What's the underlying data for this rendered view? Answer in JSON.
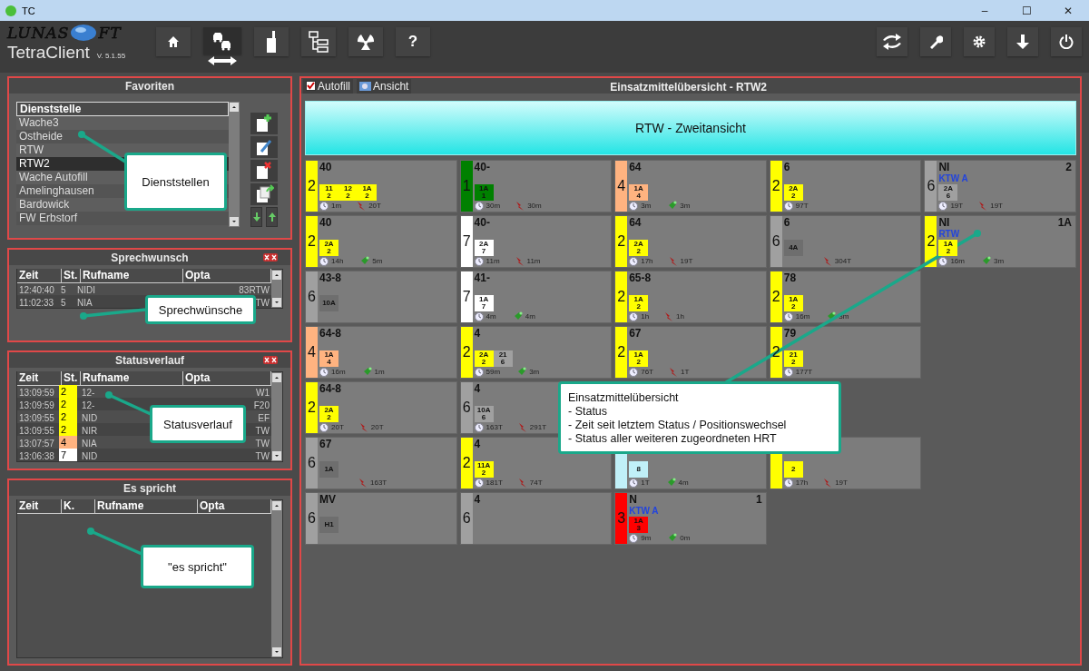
{
  "window": {
    "title": "TC",
    "controls": [
      "–",
      "☐",
      "✕"
    ]
  },
  "header": {
    "logo_left": "LUNAS",
    "logo_right": "FT",
    "app": "TetraClient",
    "version": "V. 5.1.55"
  },
  "tools": [
    {
      "kind": "home",
      "selected": false
    },
    {
      "kind": "vehicles",
      "selected": true
    },
    {
      "kind": "radio",
      "selected": false
    },
    {
      "kind": "tree",
      "selected": false
    },
    {
      "kind": "radiation",
      "selected": false
    },
    {
      "kind": "help",
      "selected": false,
      "label": "?"
    }
  ],
  "right_tools": [
    {
      "kind": "swap"
    },
    {
      "kind": "wrench"
    },
    {
      "kind": "gear"
    },
    {
      "kind": "download"
    },
    {
      "kind": "power"
    }
  ],
  "favorites": {
    "title": "Favoriten",
    "column": "Dienststelle",
    "items": [
      {
        "label": "Wache3",
        "selected": false
      },
      {
        "label": "Ostheide",
        "selected": false
      },
      {
        "label": "RTW",
        "selected": false
      },
      {
        "label": "RTW2",
        "selected": true
      },
      {
        "label": "Wache Autofill",
        "selected": false
      },
      {
        "label": "Amelinghausen",
        "selected": false
      },
      {
        "label": "Bardowick",
        "selected": false
      },
      {
        "label": "FW Erbstorf",
        "selected": false
      }
    ],
    "actions": [
      {
        "kind": "add"
      },
      {
        "kind": "edit"
      },
      {
        "kind": "delete"
      },
      {
        "kind": "copy"
      }
    ],
    "move": [
      {
        "kind": "down"
      },
      {
        "kind": "up"
      }
    ]
  },
  "sprechwunsch": {
    "title": "Sprechwunsch",
    "columns": [
      "Zeit",
      "St.",
      "Rufname",
      "Opta"
    ],
    "rows": [
      {
        "time": "12:40:40",
        "status": "5",
        "name": "NIDI",
        "opta": "83RTW"
      },
      {
        "time": "11:02:33",
        "status": "5",
        "name": "NIA",
        "opta": "TW"
      }
    ]
  },
  "statusverlauf": {
    "title": "Statusverlauf",
    "columns": [
      "Zeit",
      "St.",
      "Rufname",
      "Opta"
    ],
    "rows": [
      {
        "time": "13:09:59",
        "status": "2",
        "color": "#ffff00",
        "name": "12-",
        "opta": "W1"
      },
      {
        "time": "13:09:59",
        "status": "2",
        "color": "#ffff00",
        "name": "12-",
        "opta": "F20"
      },
      {
        "time": "13:09:55",
        "status": "2",
        "color": "#ffff00",
        "name": "NID",
        "opta": "EF"
      },
      {
        "time": "13:09:55",
        "status": "2",
        "color": "#ffff00",
        "name": "NIR",
        "opta": "TW"
      },
      {
        "time": "13:07:57",
        "status": "4",
        "color": "#ffb380",
        "name": "NIA",
        "opta": "TW"
      },
      {
        "time": "13:06:38",
        "status": "7",
        "color": "#ffffff",
        "name": "NID",
        "opta": "TW"
      }
    ]
  },
  "es_spricht": {
    "title": "Es spricht",
    "columns": [
      "Zeit",
      "K.",
      "Rufname",
      "Opta"
    ]
  },
  "overview": {
    "autofill": {
      "label": "Autofill",
      "checked": true
    },
    "view_button": "Ansicht",
    "title": "Einsatzmittelübersicht - RTW2",
    "banner": "RTW - Zweitansicht",
    "rows": [
      {
        "tiles": [
          {
            "status": "2",
            "color": "#ffff00",
            "title": "40",
            "subs": [
              {
                "label": "11",
                "value": "2",
                "color": "#ffff00"
              },
              {
                "label": "12",
                "value": "2",
                "color": "#ffff00"
              },
              {
                "label": "1A",
                "value": "2",
                "color": "#ffff00"
              }
            ],
            "time": "1m",
            "pos": {
              "kind": "antenna",
              "time": "20T"
            }
          },
          {
            "status": "1",
            "color": "#008000",
            "title": "40-",
            "subs": [
              {
                "label": "1A",
                "value": "1",
                "color": "#008000"
              }
            ],
            "time": "30m",
            "pos": {
              "kind": "antenna",
              "time": "30m"
            }
          },
          {
            "status": "4",
            "color": "#ffb380",
            "title": "64",
            "subs": [
              {
                "label": "1A",
                "value": "4",
                "color": "#ffb380"
              }
            ],
            "time": "3m",
            "pos": {
              "kind": "satellite",
              "time": "3m"
            }
          },
          {
            "status": "2",
            "color": "#ffff00",
            "title": "6",
            "subs": [
              {
                "label": "2A",
                "value": "2",
                "color": "#ffff00"
              }
            ],
            "time": "97T"
          },
          {
            "status": "6",
            "color": "#a0a0a0",
            "title": "NI",
            "corner": "2",
            "tag": "KTW A",
            "subs": [
              {
                "label": "2A",
                "value": "6",
                "color": "#a0a0a0"
              }
            ],
            "time": "19T",
            "pos": {
              "kind": "antenna",
              "time": "19T"
            }
          }
        ]
      },
      {
        "tiles": [
          {
            "status": "2",
            "color": "#ffff00",
            "title": "40",
            "subs": [
              {
                "label": "2A",
                "value": "2",
                "color": "#ffff00"
              }
            ],
            "time": "14h",
            "pos": {
              "kind": "satellite",
              "time": "5m"
            }
          },
          {
            "status": "7",
            "color": "#ffffff",
            "title": "40-",
            "subs": [
              {
                "label": "2A",
                "value": "7",
                "color": "#ffffff"
              }
            ],
            "time": "11m",
            "pos": {
              "kind": "antenna",
              "time": "11m"
            }
          },
          {
            "status": "2",
            "color": "#ffff00",
            "title": "64",
            "subs": [
              {
                "label": "2A",
                "value": "2",
                "color": "#ffff00"
              }
            ],
            "time": "17h",
            "pos": {
              "kind": "antenna",
              "time": "19T"
            }
          },
          {
            "status": "6",
            "color": "#a0a0a0",
            "title": "6",
            "subs": [
              {
                "label": "4A"
              }
            ],
            "pos": {
              "kind": "antenna",
              "time": "304T"
            }
          },
          {
            "status": "2",
            "color": "#ffff00",
            "title": "NI",
            "corner": "1A",
            "tag": "RTW",
            "subs": [
              {
                "label": "1A",
                "value": "2",
                "color": "#ffff00"
              }
            ],
            "time": "16m",
            "pos": {
              "kind": "satellite",
              "time": "3m"
            }
          }
        ]
      },
      {
        "tiles": [
          {
            "status": "6",
            "color": "#a0a0a0",
            "title": "43-8",
            "subs": [
              {
                "label": "10A"
              }
            ]
          },
          {
            "status": "7",
            "color": "#ffffff",
            "title": "41-",
            "subs": [
              {
                "label": "1A",
                "value": "7",
                "color": "#ffffff"
              }
            ],
            "time": "4m",
            "pos": {
              "kind": "satellite",
              "time": "4m"
            }
          },
          {
            "status": "2",
            "color": "#ffff00",
            "title": "65-8",
            "subs": [
              {
                "label": "1A",
                "value": "2",
                "color": "#ffff00"
              }
            ],
            "time": "1h",
            "pos": {
              "kind": "antenna",
              "time": "1h"
            }
          },
          {
            "status": "2",
            "color": "#ffff00",
            "title": "78",
            "subs": [
              {
                "label": "1A",
                "value": "2",
                "color": "#ffff00"
              }
            ],
            "time": "16m",
            "pos": {
              "kind": "satellite",
              "time": "3m"
            }
          }
        ]
      },
      {
        "tiles": [
          {
            "status": "4",
            "color": "#ffb380",
            "title": "64-8",
            "subs": [
              {
                "label": "1A",
                "value": "4",
                "color": "#ffb380"
              }
            ],
            "time": "16m",
            "pos": {
              "kind": "satellite",
              "time": "1m"
            }
          },
          {
            "status": "2",
            "color": "#ffff00",
            "title": "4",
            "subs": [
              {
                "label": "2A",
                "value": "2",
                "color": "#ffff00"
              },
              {
                "label": "21",
                "value": "6",
                "color": "#a0a0a0"
              }
            ],
            "time": "59m",
            "pos": {
              "kind": "satellite",
              "time": "3m"
            }
          },
          {
            "status": "2",
            "color": "#ffff00",
            "title": "67",
            "subs": [
              {
                "label": "1A",
                "value": "2",
                "color": "#ffff00"
              }
            ],
            "time": "76T",
            "pos": {
              "kind": "antenna",
              "time": "1T"
            }
          },
          {
            "status": "2",
            "color": "#ffff00",
            "title": "79",
            "subs": [
              {
                "label": "21",
                "value": "2",
                "color": "#ffff00"
              }
            ],
            "time": "177T"
          }
        ]
      },
      {
        "tiles": [
          {
            "status": "2",
            "color": "#ffff00",
            "title": "64-8",
            "subs": [
              {
                "label": "2A",
                "value": "2",
                "color": "#ffff00"
              }
            ],
            "time": "20T",
            "pos": {
              "kind": "antenna",
              "time": "20T"
            }
          },
          {
            "status": "6",
            "color": "#a0a0a0",
            "title": "4",
            "subs": [
              {
                "label": "10A",
                "value": "6",
                "color": "#a0a0a0"
              }
            ],
            "time": "163T",
            "pos": {
              "kind": "antenna",
              "time": "291T"
            }
          }
        ]
      },
      {
        "tiles": [
          {
            "status": "6",
            "color": "#a0a0a0",
            "title": "67",
            "subs": [
              {
                "label": "1A"
              }
            ],
            "pos": {
              "kind": "antenna",
              "time": "163T"
            }
          },
          {
            "status": "2",
            "color": "#ffff00",
            "title": "4",
            "subs": [
              {
                "label": "11A",
                "value": "2",
                "color": "#ffff00"
              }
            ],
            "time": "181T",
            "pos": {
              "kind": "antenna",
              "time": "74T"
            }
          },
          {
            "color": "#c0f0f8",
            "subs": [
              {
                "value": "8",
                "color": "#c0f0f8"
              }
            ],
            "time": "1T",
            "pos": {
              "kind": "satellite",
              "time": "4m"
            }
          },
          {
            "color": "#ffff00",
            "subs": [
              {
                "value": "2",
                "color": "#ffff00"
              }
            ],
            "time": "17h",
            "pos": {
              "kind": "antenna",
              "time": "19T"
            }
          }
        ]
      },
      {
        "tiles": [
          {
            "status": "6",
            "color": "#a0a0a0",
            "title": "MV",
            "subs": [
              {
                "label": "H1"
              }
            ]
          },
          {
            "status": "6",
            "color": "#a0a0a0",
            "title": "4"
          },
          {
            "status": "3",
            "color": "#ff0000",
            "title": "N",
            "corner": "1",
            "tag": "KTW A",
            "subs": [
              {
                "label": "1A",
                "value": "3",
                "color": "#ff0000"
              }
            ],
            "time": "9m",
            "pos": {
              "kind": "satellite",
              "time": "0m"
            }
          }
        ]
      }
    ]
  },
  "callouts": [
    {
      "lines": [
        "Dienststellen"
      ]
    },
    {
      "lines": [
        "Sprechwünsche"
      ]
    },
    {
      "lines": [
        "Statusverlauf"
      ]
    },
    {
      "lines": [
        "\"es spricht\""
      ]
    },
    {
      "lines": [
        "Einsatzmittelübersicht",
        "- Status",
        "- Zeit seit letztem Status / Positionswechsel",
        "- Status aller weiteren zugeordneten HRT"
      ]
    }
  ]
}
